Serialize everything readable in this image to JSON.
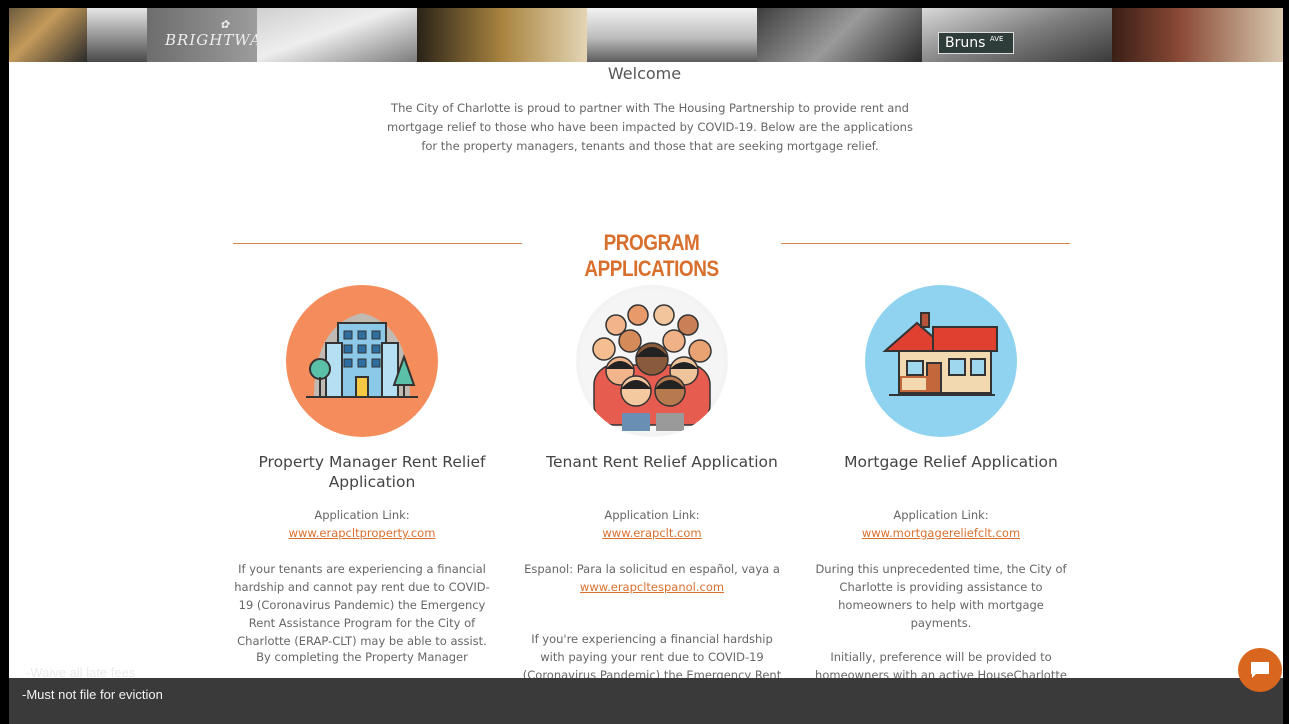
{
  "banner": {
    "brand_name": "BRIGHTWALK",
    "street_sign": "Bruns",
    "street_sign_small": "AVE"
  },
  "welcome": {
    "title": "Welcome",
    "text": "The City of Charlotte is proud to partner with The Housing Partnership to provide rent and mortgage relief to those who have been impacted by COVID-19. Below are the applications for the property managers, tenants and those that are seeking mortgage relief."
  },
  "section": {
    "title": "PROGRAM APPLICATIONS"
  },
  "cards": [
    {
      "title": "Property Manager Rent Relief Application",
      "link_label": "Application Link:",
      "link_url": "www.erapcltproperty.com",
      "desc1": "If your tenants are experiencing a financial hardship and cannot pay rent due to COVID-19 (Coronavirus Pandemic) the Emergency Rent Assistance Program for the City of Charlotte (ERAP-CLT) may be able to assist.",
      "desc2": "By completing the Property Manager",
      "icon": "apartment-building-icon",
      "circle_color": "#f58c5b"
    },
    {
      "title": "Tenant Rent Relief Application",
      "link_label": "Application Link:",
      "link_url": "www.erapclt.com",
      "desc1_prefix": "Espanol: Para la solicitud en español, vaya a",
      "desc1_url": "www.erapcltespanol.com",
      "desc2": "If you're experiencing a financial hardship with paying your rent due to COVID-19 (Coronavirus Pandemic) the Emergency Rent",
      "icon": "crowd-people-icon",
      "circle_color": "#f3f3f3"
    },
    {
      "title": "Mortgage Relief Application",
      "link_label": "Application Link:",
      "link_url": "www.mortgagereliefclt.com",
      "desc1": "During this unprecedented time, the City of Charlotte is providing assistance to homeowners to help with mortgage payments.",
      "desc2": "Initially, preference will be provided to homeowners with an active HouseCharlotte",
      "icon": "house-icon",
      "circle_color": "#8fd3f0"
    }
  ],
  "overlay": {
    "line1": "-Waive all late fees",
    "line2": "-Must not file for eviction"
  },
  "colors": {
    "accent": "#d96f2c",
    "link": "#d9702f",
    "chat": "#d9661e",
    "overlay": "#3a3a3a"
  }
}
